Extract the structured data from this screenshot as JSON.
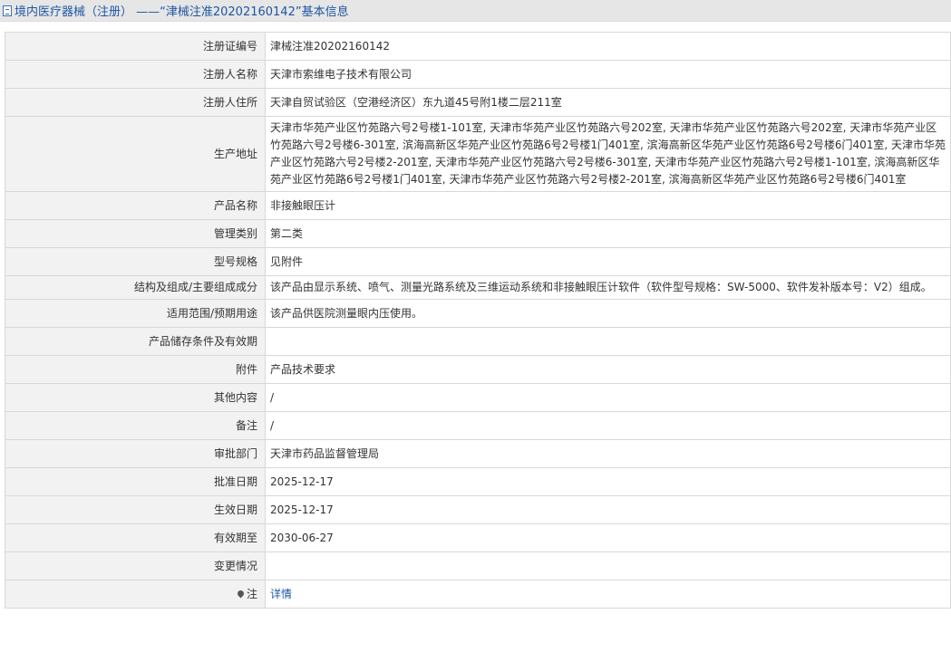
{
  "header": {
    "title": "境内医疗器械（注册）  ——“津械注准20202160142”基本信息"
  },
  "rows": [
    {
      "label": "注册证编号",
      "value": "津械注准20202160142"
    },
    {
      "label": "注册人名称",
      "value": "天津市索维电子技术有限公司"
    },
    {
      "label": "注册人住所",
      "value": "天津自贸试验区（空港经济区）东九道45号附1楼二层211室"
    },
    {
      "label": "生产地址",
      "value": "天津市华苑产业区竹苑路六号2号楼1-101室, 天津市华苑产业区竹苑路六号202室, 天津市华苑产业区竹苑路六号202室, 天津市华苑产业区竹苑路六号2号楼6-301室, 滨海高新区华苑产业区竹苑路6号2号楼1门401室, 滨海高新区华苑产业区竹苑路6号2号楼6门401室, 天津市华苑产业区竹苑路六号2号楼2-201室, 天津市华苑产业区竹苑路六号2号楼6-301室, 天津市华苑产业区竹苑路六号2号楼1-101室, 滨海高新区华苑产业区竹苑路6号2号楼1门401室, 天津市华苑产业区竹苑路六号2号楼2-201室, 滨海高新区华苑产业区竹苑路6号2号楼6门401室"
    },
    {
      "label": "产品名称",
      "value": "非接触眼压计"
    },
    {
      "label": "管理类别",
      "value": "第二类"
    },
    {
      "label": "型号规格",
      "value": "见附件"
    },
    {
      "label": "结构及组成/主要组成成分",
      "value": "该产品由显示系统、喷气、测量光路系统及三维运动系统和非接触眼压计软件（软件型号规格：SW-5000、软件发补版本号：V2）组成。"
    },
    {
      "label": "适用范围/预期用途",
      "value": "该产品供医院测量眼内压使用。"
    },
    {
      "label": "产品储存条件及有效期",
      "value": ""
    },
    {
      "label": "附件",
      "value": "产品技术要求"
    },
    {
      "label": "其他内容",
      "value": "/"
    },
    {
      "label": "备注",
      "value": "/"
    },
    {
      "label": "审批部门",
      "value": "天津市药品监督管理局"
    },
    {
      "label": "批准日期",
      "value": "2025-12-17"
    },
    {
      "label": "生效日期",
      "value": "2025-12-17"
    },
    {
      "label": "有效期至",
      "value": "2030-06-27"
    },
    {
      "label": "变更情况",
      "value": ""
    },
    {
      "label": "注",
      "value": "详情"
    }
  ]
}
